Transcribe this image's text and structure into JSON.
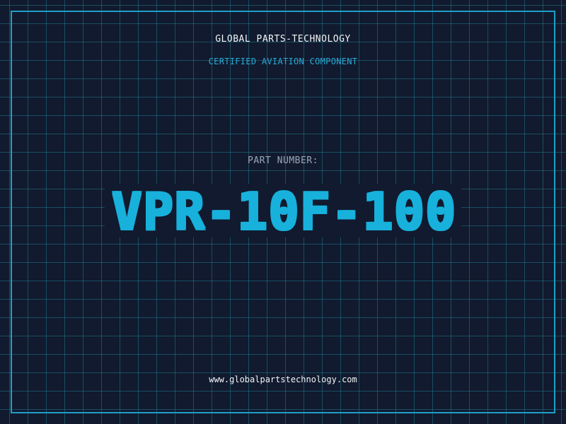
{
  "header": {
    "company": "GLOBAL PARTS-TECHNOLOGY",
    "subtitle": "CERTIFIED AVIATION COMPONENT"
  },
  "part": {
    "label": "PART NUMBER:",
    "number": "VPR-10F-100"
  },
  "footer": {
    "website": "www.globalpartstechnology.com"
  },
  "colors": {
    "background": "#111a2e",
    "grid": "#20768c",
    "accent": "#17b1dc",
    "frame": "#1ea0c8",
    "text": "#f2f4f7",
    "muted": "#9aa6b8"
  }
}
